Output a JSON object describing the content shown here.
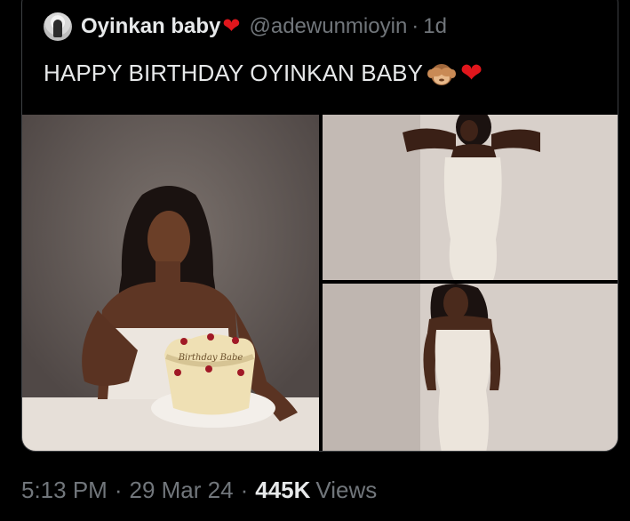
{
  "author": {
    "display_name": "Oyinkan baby",
    "name_emoji": "❤",
    "handle": "@adewunmioyin",
    "separator": "·",
    "time_ago": "1d"
  },
  "tweet": {
    "text": "HAPPY BIRTHDAY OYINKAN BABY",
    "emoji_1": "see-no-evil-monkey",
    "emoji_2": "❤"
  },
  "media": {
    "images": [
      {
        "name": "woman-with-birthday-cake-photo",
        "cake_text": "Birthday Babe"
      },
      {
        "name": "woman-in-white-dress-photo-1"
      },
      {
        "name": "woman-in-white-dress-photo-2"
      }
    ]
  },
  "footer": {
    "time": "5:13 PM",
    "separator": "·",
    "date": "29 Mar 24",
    "views_count": "445K",
    "views_label": "Views"
  },
  "colors": {
    "background": "#000000",
    "text_primary": "#e7e9ea",
    "text_secondary": "#71767b",
    "heart": "#e0161c",
    "border": "#3e4144"
  }
}
